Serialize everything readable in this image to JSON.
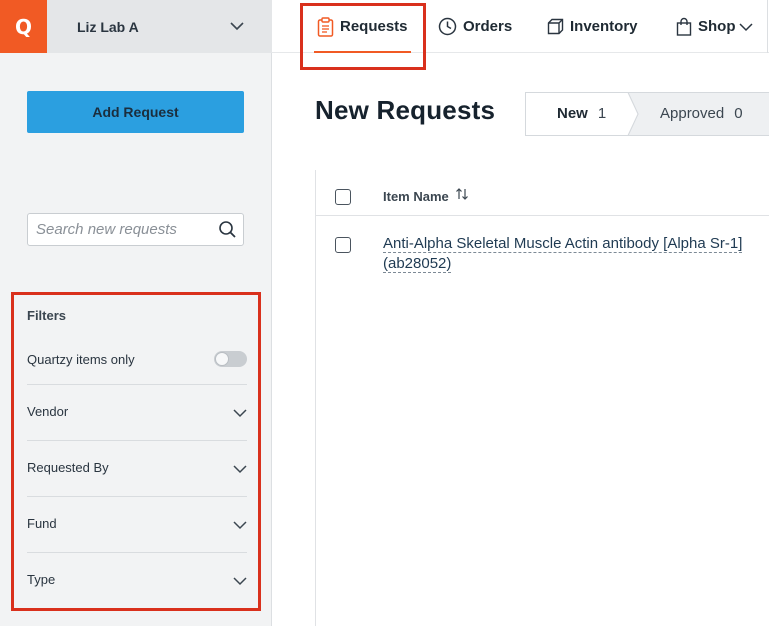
{
  "app": {
    "logo_letter": "Q",
    "accent_color": "#f15a24",
    "lab_name": "Liz Lab A"
  },
  "sidebar": {
    "add_request_label": "Add Request",
    "search_placeholder": "Search new requests",
    "filters": {
      "title": "Filters",
      "quartzy_toggle_label": "Quartzy items only",
      "quartzy_toggle_on": false,
      "items": [
        {
          "label": "Vendor"
        },
        {
          "label": "Requested By"
        },
        {
          "label": "Fund"
        },
        {
          "label": "Type"
        }
      ]
    }
  },
  "nav": {
    "requests": "Requests",
    "orders": "Orders",
    "inventory": "Inventory",
    "shop": "Shop",
    "active": "Requests"
  },
  "main": {
    "title": "New Requests",
    "tabs": {
      "new_label": "New",
      "new_count": "1",
      "approved_label": "Approved",
      "approved_count": "0"
    },
    "table": {
      "column_item_name": "Item Name",
      "rows": [
        {
          "item_name": "Anti-Alpha Skeletal Muscle Actin antibody [Alpha Sr-1] (ab28052)"
        }
      ]
    }
  },
  "icons": {
    "search": "search-icon",
    "chevron": "chevron-down-icon",
    "clipboard": "clipboard-icon",
    "clock": "clock-icon",
    "box": "box-icon",
    "bag": "shopping-bag-icon",
    "sort": "sort-icon"
  }
}
